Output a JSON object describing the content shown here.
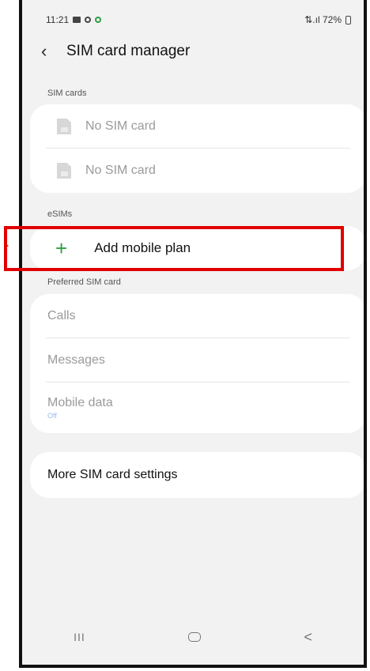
{
  "status_bar": {
    "time": "11:21",
    "right_text": "⇅.ıl 72%",
    "battery_icon": "battery-icon"
  },
  "header": {
    "title": "SIM card manager",
    "back_icon": "back-arrow-icon"
  },
  "sim_cards": {
    "section_label": "SIM cards",
    "items": [
      {
        "label": "No SIM card",
        "icon": "sim-card-icon"
      },
      {
        "label": "No SIM card",
        "icon": "sim-card-icon"
      }
    ]
  },
  "esims": {
    "section_label": "eSIMs",
    "add_label": "Add mobile plan",
    "add_icon": "plus-icon"
  },
  "preferred_sim": {
    "section_label": "Preferred SIM card",
    "items": [
      {
        "label": "Calls"
      },
      {
        "label": "Messages"
      },
      {
        "label": "Mobile data",
        "sub": "Off"
      }
    ]
  },
  "more": {
    "label": "More SIM card settings"
  },
  "nav_bar": {
    "recent_icon": "recent-apps-icon",
    "home_icon": "home-icon",
    "back_icon": "nav-back-icon"
  },
  "colors": {
    "accent_green": "#2ea043",
    "highlight_red": "#e00000",
    "subtext_blue": "#9bbbe8"
  }
}
